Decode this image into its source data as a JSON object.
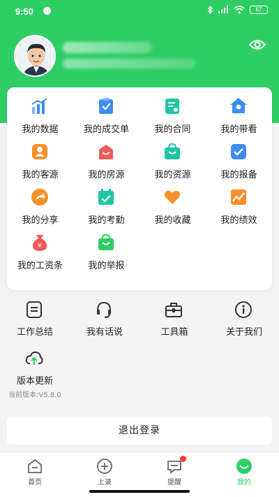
{
  "status_bar": {
    "time": "9:50",
    "battery": "67"
  },
  "grid": {
    "items": [
      {
        "label": "我的数据",
        "icon": "bar-chart-icon"
      },
      {
        "label": "我的成交单",
        "icon": "clipboard-check-icon"
      },
      {
        "label": "我的合同",
        "icon": "contract-icon"
      },
      {
        "label": "我的带看",
        "icon": "house-location-icon"
      },
      {
        "label": "我的客源",
        "icon": "customer-icon"
      },
      {
        "label": "我的房源",
        "icon": "house-bag-icon"
      },
      {
        "label": "我的资源",
        "icon": "resource-bag-icon"
      },
      {
        "label": "我的报备",
        "icon": "checkbox-icon"
      },
      {
        "label": "我的分享",
        "icon": "share-icon"
      },
      {
        "label": "我的考勤",
        "icon": "calendar-check-icon"
      },
      {
        "label": "我的收藏",
        "icon": "heart-icon"
      },
      {
        "label": "我的绩效",
        "icon": "performance-chart-icon"
      },
      {
        "label": "我的工资条",
        "icon": "money-bag-icon"
      },
      {
        "label": "我的举报",
        "icon": "report-bag-icon"
      }
    ]
  },
  "tools": {
    "items": [
      {
        "label": "工作总结",
        "icon": "document-icon"
      },
      {
        "label": "我有话说",
        "icon": "headset-icon"
      },
      {
        "label": "工具箱",
        "icon": "toolbox-icon"
      },
      {
        "label": "关于我们",
        "icon": "info-icon"
      },
      {
        "label": "版本更新",
        "icon": "cloud-upload-icon"
      }
    ],
    "version": "当前版本:V5.8.0"
  },
  "logout_label": "退出登录",
  "tabbar": {
    "items": [
      {
        "label": "首页",
        "icon": "home-icon"
      },
      {
        "label": "上录",
        "icon": "plus-circle-icon"
      },
      {
        "label": "提醒",
        "icon": "message-icon"
      },
      {
        "label": "我的",
        "icon": "profile-smile-icon"
      }
    ]
  },
  "colors": {
    "brand_green": "#2fce65",
    "blue": "#3d8cf0",
    "orange": "#f5902a",
    "red": "#f25a5a",
    "teal": "#1ec6a4"
  }
}
